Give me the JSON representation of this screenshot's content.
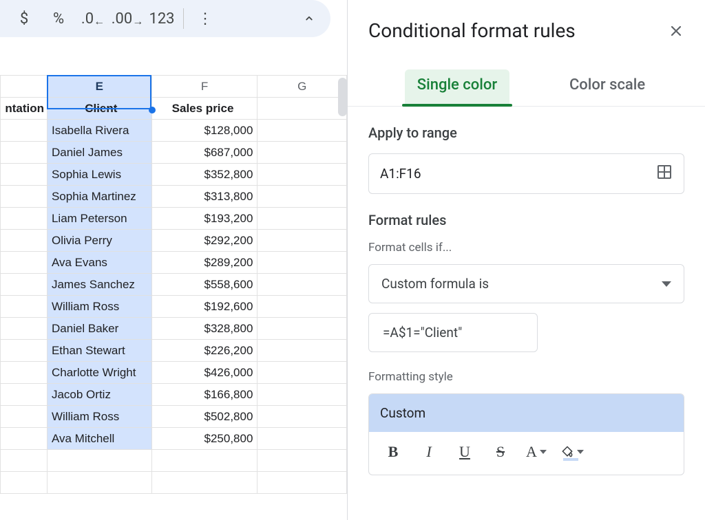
{
  "toolbar": {
    "currency": "$",
    "percent": "%",
    "dec_less": ".0",
    "dec_more": ".00",
    "num_fmt": "123",
    "more": "⋮"
  },
  "columns": {
    "D_partial": "ntation",
    "E": "E",
    "F": "F",
    "G": "G"
  },
  "headers": {
    "client": "Client",
    "sales_price": "Sales price"
  },
  "rows": [
    {
      "client": "Isabella Rivera",
      "price": "$128,000"
    },
    {
      "client": "Daniel James",
      "price": "$687,000"
    },
    {
      "client": "Sophia Lewis",
      "price": "$352,800"
    },
    {
      "client": "Sophia Martinez",
      "price": "$313,800"
    },
    {
      "client": "Liam Peterson",
      "price": "$193,200"
    },
    {
      "client": "Olivia Perry",
      "price": "$292,200"
    },
    {
      "client": "Ava Evans",
      "price": "$289,200"
    },
    {
      "client": "James Sanchez",
      "price": "$558,600"
    },
    {
      "client": "William Ross",
      "price": "$192,600"
    },
    {
      "client": "Daniel Baker",
      "price": "$328,800"
    },
    {
      "client": "Ethan Stewart",
      "price": "$226,200"
    },
    {
      "client": "Charlotte Wright",
      "price": "$426,000"
    },
    {
      "client": "Jacob Ortiz",
      "price": "$166,800"
    },
    {
      "client": "William Ross",
      "price": "$502,800"
    },
    {
      "client": "Ava Mitchell",
      "price": "$250,800"
    }
  ],
  "panel": {
    "title": "Conditional format rules",
    "tab_single": "Single color",
    "tab_scale": "Color scale",
    "apply_range_h": "Apply to range",
    "range_value": "A1:F16",
    "rules_h": "Format rules",
    "cells_if": "Format cells if...",
    "condition": "Custom formula is",
    "formula": "=A$1=\"Client\"",
    "style_h": "Formatting style",
    "style_name": "Custom",
    "bold": "B",
    "italic": "I",
    "underline": "U",
    "strike": "S",
    "textcolor": "A"
  },
  "colors": {
    "highlight": "#c6d9f6",
    "accent": "#188038"
  }
}
